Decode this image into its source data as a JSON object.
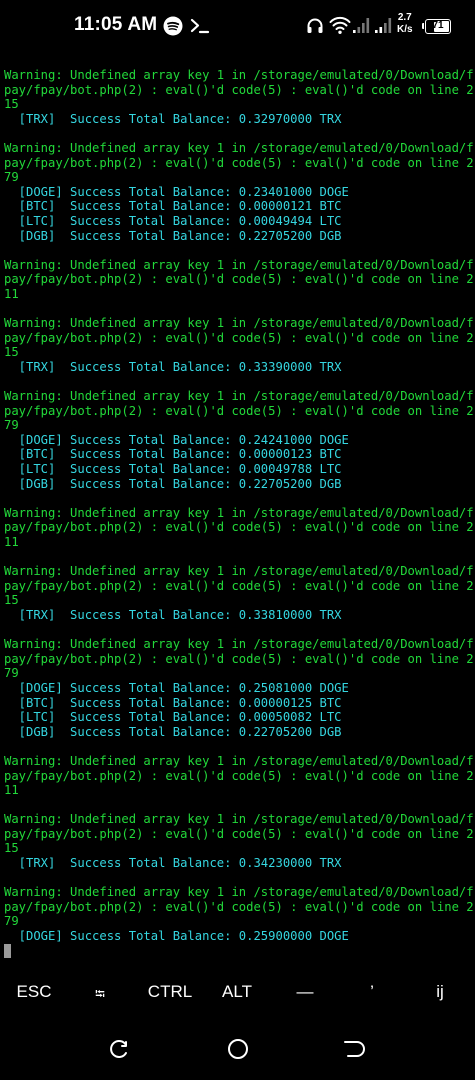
{
  "status_bar": {
    "time": "11:05 AM",
    "network_speed_value": "2.7",
    "network_speed_unit": "K/s",
    "battery_level": "71",
    "icons": [
      "spotify-icon",
      "terminal-prompt-icon",
      "headphones-icon",
      "wifi-icon",
      "signal-icon",
      "signal-icon-2",
      "battery-icon"
    ]
  },
  "terminal": {
    "lines": [
      {
        "text": "Warning: Undefined array key 1 in /storage/emulated/0/Download/f",
        "kind": "warn"
      },
      {
        "text": "pay/fpay/bot.php(2) : eval()'d code(5) : eval()'d code on line 2",
        "kind": "warn"
      },
      {
        "text": "15",
        "kind": "warn"
      },
      {
        "text": "  [TRX]  Success Total Balance: 0.32970000 TRX",
        "kind": "bal"
      },
      {
        "text": "",
        "kind": "blank"
      },
      {
        "text": "Warning: Undefined array key 1 in /storage/emulated/0/Download/f",
        "kind": "warn"
      },
      {
        "text": "pay/fpay/bot.php(2) : eval()'d code(5) : eval()'d code on line 2",
        "kind": "warn"
      },
      {
        "text": "79",
        "kind": "warn"
      },
      {
        "text": "  [DOGE] Success Total Balance: 0.23401000 DOGE",
        "kind": "bal"
      },
      {
        "text": "  [BTC]  Success Total Balance: 0.00000121 BTC",
        "kind": "bal"
      },
      {
        "text": "  [LTC]  Success Total Balance: 0.00049494 LTC",
        "kind": "bal"
      },
      {
        "text": "  [DGB]  Success Total Balance: 0.22705200 DGB",
        "kind": "bal"
      },
      {
        "text": "",
        "kind": "blank"
      },
      {
        "text": "Warning: Undefined array key 1 in /storage/emulated/0/Download/f",
        "kind": "warn"
      },
      {
        "text": "pay/fpay/bot.php(2) : eval()'d code(5) : eval()'d code on line 2",
        "kind": "warn"
      },
      {
        "text": "11",
        "kind": "warn"
      },
      {
        "text": "",
        "kind": "blank"
      },
      {
        "text": "Warning: Undefined array key 1 in /storage/emulated/0/Download/f",
        "kind": "warn"
      },
      {
        "text": "pay/fpay/bot.php(2) : eval()'d code(5) : eval()'d code on line 2",
        "kind": "warn"
      },
      {
        "text": "15",
        "kind": "warn"
      },
      {
        "text": "  [TRX]  Success Total Balance: 0.33390000 TRX",
        "kind": "bal"
      },
      {
        "text": "",
        "kind": "blank"
      },
      {
        "text": "Warning: Undefined array key 1 in /storage/emulated/0/Download/f",
        "kind": "warn"
      },
      {
        "text": "pay/fpay/bot.php(2) : eval()'d code(5) : eval()'d code on line 2",
        "kind": "warn"
      },
      {
        "text": "79",
        "kind": "warn"
      },
      {
        "text": "  [DOGE] Success Total Balance: 0.24241000 DOGE",
        "kind": "bal"
      },
      {
        "text": "  [BTC]  Success Total Balance: 0.00000123 BTC",
        "kind": "bal"
      },
      {
        "text": "  [LTC]  Success Total Balance: 0.00049788 LTC",
        "kind": "bal"
      },
      {
        "text": "  [DGB]  Success Total Balance: 0.22705200 DGB",
        "kind": "bal"
      },
      {
        "text": "",
        "kind": "blank"
      },
      {
        "text": "Warning: Undefined array key 1 in /storage/emulated/0/Download/f",
        "kind": "warn"
      },
      {
        "text": "pay/fpay/bot.php(2) : eval()'d code(5) : eval()'d code on line 2",
        "kind": "warn"
      },
      {
        "text": "11",
        "kind": "warn"
      },
      {
        "text": "",
        "kind": "blank"
      },
      {
        "text": "Warning: Undefined array key 1 in /storage/emulated/0/Download/f",
        "kind": "warn"
      },
      {
        "text": "pay/fpay/bot.php(2) : eval()'d code(5) : eval()'d code on line 2",
        "kind": "warn"
      },
      {
        "text": "15",
        "kind": "warn"
      },
      {
        "text": "  [TRX]  Success Total Balance: 0.33810000 TRX",
        "kind": "bal"
      },
      {
        "text": "",
        "kind": "blank"
      },
      {
        "text": "Warning: Undefined array key 1 in /storage/emulated/0/Download/f",
        "kind": "warn"
      },
      {
        "text": "pay/fpay/bot.php(2) : eval()'d code(5) : eval()'d code on line 2",
        "kind": "warn"
      },
      {
        "text": "79",
        "kind": "warn"
      },
      {
        "text": "  [DOGE] Success Total Balance: 0.25081000 DOGE",
        "kind": "bal"
      },
      {
        "text": "  [BTC]  Success Total Balance: 0.00000125 BTC",
        "kind": "bal"
      },
      {
        "text": "  [LTC]  Success Total Balance: 0.00050082 LTC",
        "kind": "bal"
      },
      {
        "text": "  [DGB]  Success Total Balance: 0.22705200 DGB",
        "kind": "bal"
      },
      {
        "text": "",
        "kind": "blank"
      },
      {
        "text": "Warning: Undefined array key 1 in /storage/emulated/0/Download/f",
        "kind": "warn"
      },
      {
        "text": "pay/fpay/bot.php(2) : eval()'d code(5) : eval()'d code on line 2",
        "kind": "warn"
      },
      {
        "text": "11",
        "kind": "warn"
      },
      {
        "text": "",
        "kind": "blank"
      },
      {
        "text": "Warning: Undefined array key 1 in /storage/emulated/0/Download/f",
        "kind": "warn"
      },
      {
        "text": "pay/fpay/bot.php(2) : eval()'d code(5) : eval()'d code on line 2",
        "kind": "warn"
      },
      {
        "text": "15",
        "kind": "warn"
      },
      {
        "text": "  [TRX]  Success Total Balance: 0.34230000 TRX",
        "kind": "bal"
      },
      {
        "text": "",
        "kind": "blank"
      },
      {
        "text": "Warning: Undefined array key 1 in /storage/emulated/0/Download/f",
        "kind": "warn"
      },
      {
        "text": "pay/fpay/bot.php(2) : eval()'d code(5) : eval()'d code on line 2",
        "kind": "warn"
      },
      {
        "text": "79",
        "kind": "warn"
      },
      {
        "text": "  [DOGE] Success Total Balance: 0.25900000 DOGE",
        "kind": "bal"
      }
    ],
    "colors": {
      "warning": "#22d93a",
      "balance": "#35d6e0",
      "cursor": "#9a9a9a",
      "background": "#000000"
    }
  },
  "extra_keys": [
    {
      "label": "ESC",
      "name": "esc-key"
    },
    {
      "label": "⭾",
      "name": "tab-key"
    },
    {
      "label": "CTRL",
      "name": "ctrl-key"
    },
    {
      "label": "ALT",
      "name": "alt-key"
    },
    {
      "label": "—",
      "name": "dash-key"
    },
    {
      "label": "’",
      "name": "quote-key"
    },
    {
      "label": "ij",
      "name": "ij-key"
    }
  ],
  "nav_bar": {
    "buttons": [
      "recents-button",
      "home-button",
      "back-button"
    ]
  }
}
